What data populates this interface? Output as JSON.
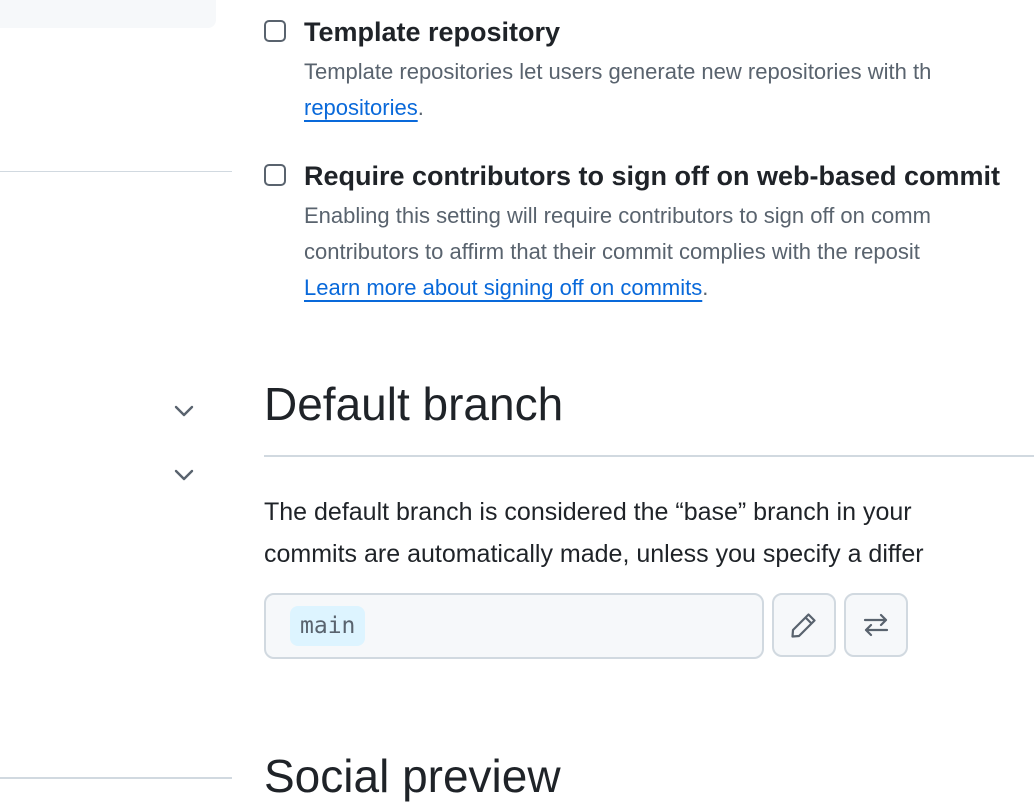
{
  "template": {
    "title": "Template repository",
    "desc_line1": "Template repositories let users generate new repositories with th",
    "link": "repositories",
    "after_link": "."
  },
  "signoff": {
    "title": "Require contributors to sign off on web-based commit",
    "desc_line1": "Enabling this setting will require contributors to sign off on comm",
    "desc_line2": "contributors to affirm that their commit complies with the reposit",
    "link": "Learn more about signing off on commits",
    "after_link": "."
  },
  "default_branch": {
    "heading": "Default branch",
    "para_line1": "The default branch is considered the “base” branch in your",
    "para_line2": "commits are automatically made, unless you specify a differ",
    "branch_name": "main"
  },
  "social_preview": {
    "heading": "Social preview"
  },
  "icons": {
    "edit": "pencil-icon",
    "switch": "arrow-switch-icon",
    "expand": "chevron-down-icon",
    "collapse": "chevron-up-icon"
  },
  "colors": {
    "link": "#0969da",
    "muted": "#59636e",
    "border": "#d1d9e0",
    "chip_bg": "#ddf4ff"
  }
}
